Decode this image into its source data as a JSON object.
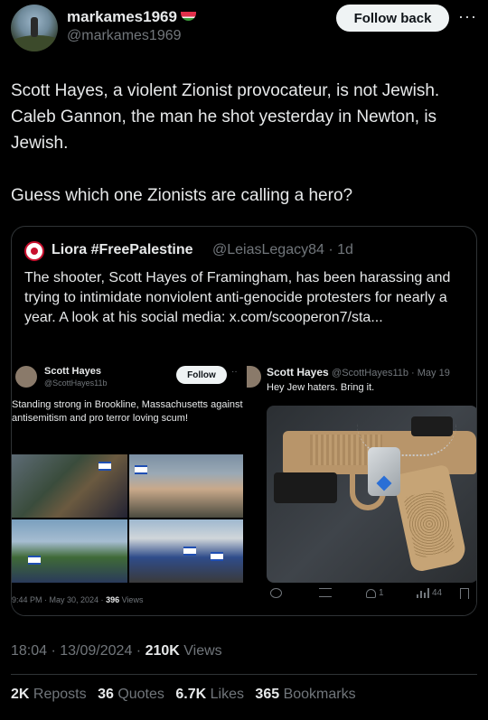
{
  "header": {
    "display_name": "markames1969",
    "handle": "@markames1969",
    "follow_button": "Follow back",
    "more": "···"
  },
  "tweet": {
    "text": "Scott Hayes, a violent Zionist provocateur, is not Jewish. Caleb Gannon, the man he shot yesterday in Newton, is Jewish.\n\nGuess which one Zionists are calling a hero?",
    "timestamp": "18:04 · 13/09/2024 · ",
    "views_count": "210K",
    "views_label": " Views"
  },
  "quote": {
    "display_name": "Liora #FreePalestine",
    "handle_time": "@LeiasLegacy84 · 1d",
    "text": "The shooter, Scott Hayes of Framingham, has been harassing and trying to intimidate nonviolent anti-genocide protesters for nearly a year. A look at his social media: x.com/scooperon7/sta...",
    "screenshot_left": {
      "name": "Scott Hayes",
      "handle": "@ScottHayes11b",
      "follow": "Follow",
      "text": "Standing strong in Brookline, Massachusetts against antisemitism and pro terror loving scum!",
      "meta_time": "9:44 PM · May 30, 2024 · ",
      "meta_views_count": "396",
      "meta_views_label": " Views"
    },
    "screenshot_right": {
      "name": "Scott Hayes",
      "handle_time": "@ScottHayes11b · May 19",
      "text": "Hey Jew haters. Bring it.",
      "likes": "1",
      "views": "44"
    }
  },
  "stats": {
    "reposts_count": "2K",
    "reposts_label": "Reposts",
    "quotes_count": "36",
    "quotes_label": "Quotes",
    "likes_count": "6.7K",
    "likes_label": "Likes",
    "bookmarks_count": "365",
    "bookmarks_label": "Bookmarks"
  },
  "icons": {
    "avatar": "avatar-icon",
    "watermelon": "watermelon-icon",
    "reply": "reply-icon",
    "repost": "repost-icon",
    "like": "heart-icon",
    "views": "views-icon",
    "bookmark": "bookmark-icon"
  }
}
